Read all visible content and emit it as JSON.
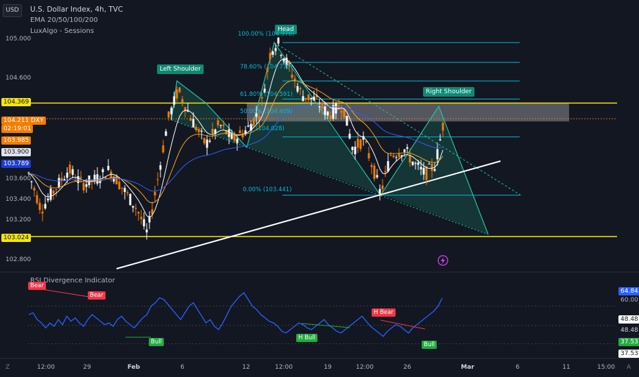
{
  "toolbar": {
    "currency": "USD"
  },
  "legend": {
    "title": "U.S. Dollar Index, 4h, TVC",
    "ema": "EMA 20/50/100/200",
    "sessions": "LuxAlgo - Sessions"
  },
  "price_axis": {
    "ticks": [
      "105.000",
      "104.600",
      "103.600",
      "103.400",
      "103.200",
      "102.800"
    ],
    "badges": {
      "upper_level": "104.369",
      "last_price": "104.211",
      "countdown": "02:19:01",
      "symbol": "DXY",
      "ema_a": "103.985",
      "ema_b": "103.900",
      "ema_c": "103.789",
      "lower_level": "103.024"
    }
  },
  "pattern": {
    "left_shoulder": "Left Shoulder",
    "head": "Head",
    "right_shoulder": "Right Shoulder"
  },
  "fib": {
    "f100": "100.00% (104.978)",
    "f786": "78.60% (104.779)",
    "f618": "61.80% (104.591)",
    "f50": "50.00% (104.409)",
    "f_partial": "(104.028)",
    "f0": "0.00% (103.441)"
  },
  "rsi": {
    "title": "RSI Divergence Indicator",
    "values": {
      "current": "64.84",
      "level_high": "60.00",
      "v1": "48.48",
      "v2": "48.48",
      "v3": "37.53",
      "v4": "37.53"
    },
    "signals": {
      "bear1": "Bear",
      "bear2": "Bear",
      "hbear": "H Bear",
      "bull1": "Bull",
      "hbull": "H Bull",
      "bull2": "Bull"
    }
  },
  "time_axis": {
    "ticks": [
      "12:00",
      "29",
      "Feb",
      "6",
      "12",
      "12:00",
      "19",
      "12:00",
      "26",
      "Mar",
      "6",
      "11",
      "15:00"
    ],
    "corner_left": "Z",
    "corner_right": "A"
  },
  "chart_data": {
    "type": "candlestick",
    "symbol": "DXY",
    "interval": "4h",
    "y_range": [
      102.7,
      105.2
    ],
    "levels": [
      104.369,
      103.024
    ],
    "pattern_points": {
      "left_shoulder": 104.5,
      "head": 104.978,
      "right_shoulder": 104.35,
      "neckline_low": 103.441
    },
    "rsi_series": [
      55,
      56,
      52,
      50,
      47,
      50,
      48,
      52,
      49,
      54,
      51,
      53,
      50,
      48,
      52,
      55,
      53,
      51,
      49,
      50,
      48,
      52,
      54,
      51,
      49,
      47,
      50,
      53,
      55,
      60,
      62,
      65,
      64,
      61,
      58,
      55,
      52,
      56,
      60,
      62,
      58,
      54,
      50,
      52,
      48,
      46,
      50,
      55,
      60,
      63,
      66,
      68,
      64,
      60,
      58,
      55,
      53,
      51,
      50,
      48,
      45,
      44,
      46,
      48,
      50,
      49,
      47,
      46,
      48,
      50,
      52,
      49,
      47,
      45,
      44,
      46,
      48,
      50,
      52,
      54,
      51,
      48,
      46,
      44,
      42,
      45,
      47,
      49,
      48,
      46,
      44,
      47,
      49,
      51,
      53,
      55,
      57,
      60,
      64.84
    ]
  }
}
